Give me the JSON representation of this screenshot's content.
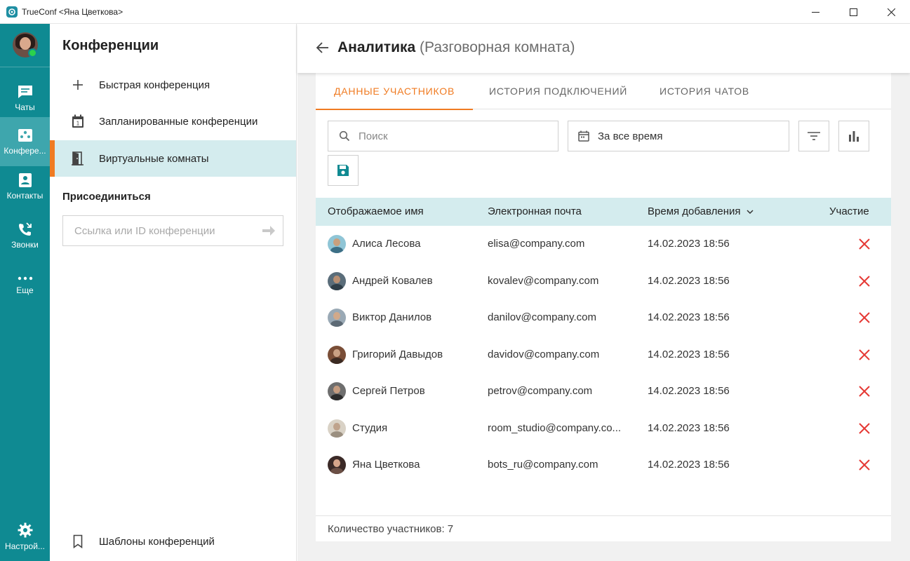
{
  "window": {
    "title": "TrueConf <Яна Цветкова>"
  },
  "rail": {
    "items": [
      {
        "label": "Чаты",
        "icon": "chat-icon"
      },
      {
        "label": "Конфере...",
        "icon": "conference-icon",
        "active": true
      },
      {
        "label": "Контакты",
        "icon": "contacts-icon"
      },
      {
        "label": "Звонки",
        "icon": "calls-icon"
      },
      {
        "label": "Еще",
        "icon": "more-icon"
      },
      {
        "label": "Настрой...",
        "icon": "settings-icon"
      }
    ]
  },
  "panel": {
    "title": "Конференции",
    "items": [
      {
        "label": "Быстрая конференция",
        "icon": "plus-icon"
      },
      {
        "label": "Запланированные конференции",
        "icon": "calendar-icon"
      },
      {
        "label": "Виртуальные комнаты",
        "icon": "door-icon",
        "active": true
      }
    ],
    "join_title": "Присоединиться",
    "join_placeholder": "Ссылка или ID конференции",
    "templates_label": "Шаблоны конференций"
  },
  "main": {
    "title": "Аналитика",
    "subtitle": "(Разговорная комната)",
    "tabs": [
      "ДАННЫЕ УЧАСТНИКОВ",
      "ИСТОРИЯ ПОДКЛЮЧЕНИЙ",
      "ИСТОРИЯ ЧАТОВ"
    ],
    "search_placeholder": "Поиск",
    "date_range": "За все время",
    "table": {
      "columns": [
        "Отображаемое имя",
        "Электронная почта",
        "Время добавления",
        "Участие"
      ],
      "rows": [
        {
          "name": "Алиса Лесова",
          "email": "elisa@company.com",
          "time": "14.02.2023 18:56",
          "participated": false
        },
        {
          "name": "Андрей Ковалев",
          "email": "kovalev@company.com",
          "time": "14.02.2023 18:56",
          "participated": false
        },
        {
          "name": "Виктор Данилов",
          "email": "danilov@company.com",
          "time": "14.02.2023 18:56",
          "participated": false
        },
        {
          "name": "Григорий Давыдов",
          "email": "davidov@company.com",
          "time": "14.02.2023 18:56",
          "participated": false
        },
        {
          "name": "Сергей Петров",
          "email": "petrov@company.com",
          "time": "14.02.2023 18:56",
          "participated": false
        },
        {
          "name": "Студия",
          "email": "room_studio@company.co...",
          "time": "14.02.2023 18:56",
          "participated": false
        },
        {
          "name": "Яна Цветкова",
          "email": "bots_ru@company.com",
          "time": "14.02.2023 18:56",
          "participated": false
        }
      ]
    },
    "participants_count": "Количество участников: 7"
  },
  "colors": {
    "rail": "#0f8a92",
    "accent": "#f07b22",
    "highlight": "#d4ecee",
    "decline": "#e53935"
  }
}
